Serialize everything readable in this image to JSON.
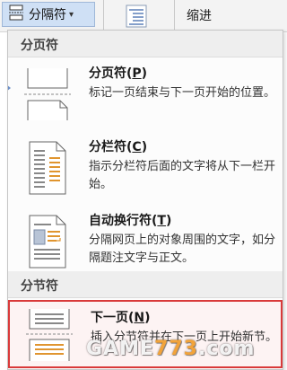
{
  "ribbon": {
    "breaks_button_label": "分隔符",
    "breaks_icon": "page-break-icon",
    "indent_icon": "indent-icon",
    "indent_label": "缩进"
  },
  "menu": {
    "page_breaks_header": "分页符",
    "section_breaks_header": "分节符",
    "items": [
      {
        "title": "分页符",
        "hotkey": "P",
        "description": "标记一页结束与下一页开始的位置。",
        "icon": "page-break-icon"
      },
      {
        "title": "分栏符",
        "hotkey": "C",
        "description": "指示分栏符后面的文字将从下一栏开始。",
        "icon": "column-break-icon"
      },
      {
        "title": "自动换行符",
        "hotkey": "T",
        "description": "分隔网页上的对象周围的文字，如分隔题注文字与正文。",
        "icon": "text-wrapping-break-icon"
      },
      {
        "title": "下一页",
        "hotkey": "N",
        "description": "插入分节符并在下一页上开始新节。",
        "icon": "next-page-section-break-icon"
      }
    ]
  },
  "watermark": {
    "text_before": "GAME",
    "text_highlight": "773",
    "text_after": ".com"
  },
  "colors": {
    "selection_border": "#d93a3a",
    "ribbon_button_bg": "#cfe0f5",
    "header_bg": "#eeeeee",
    "watermark_accent": "#f2a33a"
  }
}
